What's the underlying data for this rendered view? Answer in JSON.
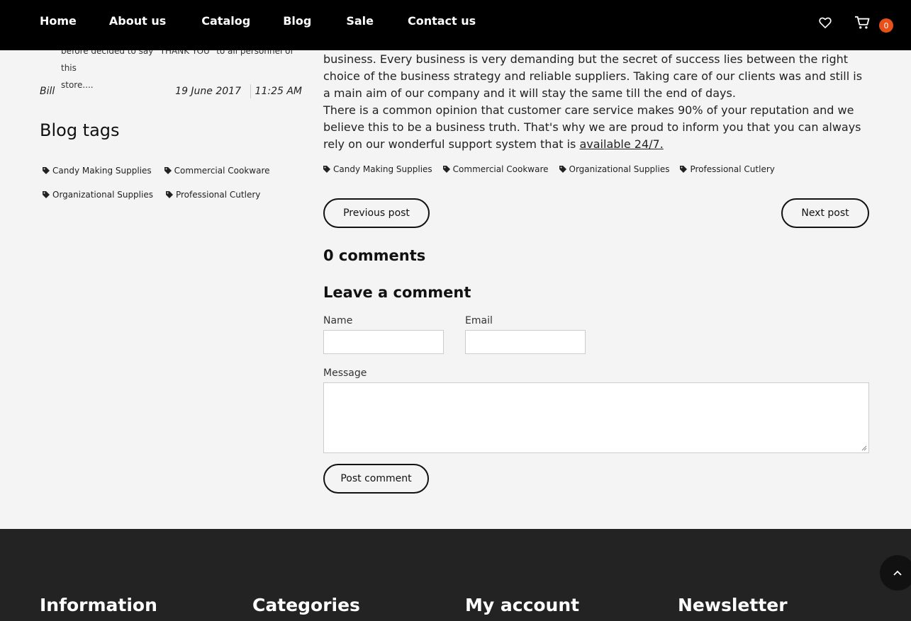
{
  "header": {
    "nav": [
      "Home",
      "About us",
      "Catalog",
      "Blog",
      "Sale",
      "Contact us"
    ],
    "cart_count": "0"
  },
  "sidebar": {
    "review_text_line1": "before decided to say \"THANK YOU\" to all personnel of this",
    "review_text_line2": "store....",
    "review_author": "Bill",
    "review_date": "19 June 2017",
    "review_time": "11:25 AM",
    "blog_tags_title": "Blog tags",
    "tags": [
      "Candy Making Supplies",
      "Commercial Cookware",
      "Organizational Supplies",
      "Professional Cutlery"
    ]
  },
  "article": {
    "line0": "business. Every business is very demanding but the secret of success lies between the right choice of the business strategy and reliable suppliers. Taking care of our clients was and still is a main aim of our company and it will stay the same till the end of days.",
    "para2": "There is a common opinion that customer care service makes 90% of your reputation and we believe this to be a business truth. That's why we are proud to inform you that you can always rely on our wonderful support system that is ",
    "link": "available 24/7.",
    "tags": [
      "Candy Making Supplies",
      "Commercial Cookware",
      "Organizational Supplies",
      "Professional Cutlery"
    ]
  },
  "pager": {
    "prev": "Previous post",
    "next": "Next post"
  },
  "comments": {
    "count": "0 comments",
    "leave_title": "Leave a comment",
    "name_label": "Name",
    "email_label": "Email",
    "message_label": "Message",
    "submit": "Post comment"
  },
  "footer": {
    "columns": [
      "Information",
      "Categories",
      "My account",
      "Newsletter"
    ]
  }
}
